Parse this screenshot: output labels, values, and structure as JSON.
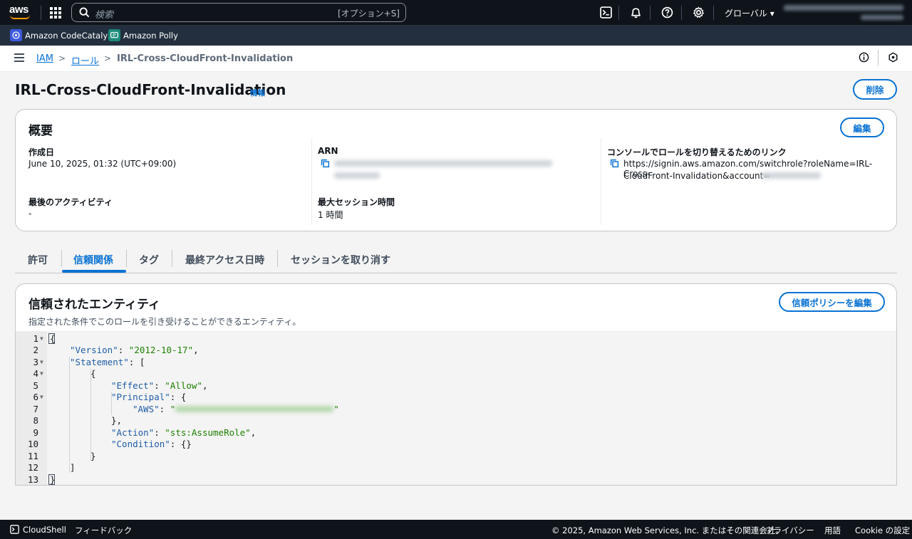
{
  "topnav": {
    "logo_text": "aws",
    "search_placeholder": "検索",
    "search_shortcut": "[オプション+S]",
    "region": "グローバル ▾"
  },
  "favorites": [
    {
      "label": "Amazon CodeCatalyst",
      "icon": "codecatalyst-icon",
      "color": "#3b5bdb"
    },
    {
      "label": "Amazon Polly",
      "icon": "polly-icon",
      "color": "#1b8a7a"
    }
  ],
  "breadcrumb": {
    "items": [
      "IAM",
      "ロール"
    ],
    "current": "IRL-Cross-CloudFront-Invalidation"
  },
  "page": {
    "title": "IRL-Cross-CloudFront-Invalidation",
    "info_label": "情報",
    "delete_label": "削除"
  },
  "summary": {
    "title": "概要",
    "edit_label": "編集",
    "created_label": "作成日",
    "created_value": "June 10, 2025, 01:32 (UTC+09:00)",
    "last_activity_label": "最後のアクティビティ",
    "last_activity_value": "-",
    "arn_label": "ARN",
    "max_session_label": "最大セッション時間",
    "max_session_value": "1 時間",
    "switch_link_label": "コンソールでロールを切り替えるためのリンク",
    "switch_link_line1": "https://signin.aws.amazon.com/switchrole?roleName=IRL-Cross-",
    "switch_link_line2": "CloudFront-Invalidation&account="
  },
  "tabs": [
    {
      "label": "許可",
      "active": false
    },
    {
      "label": "信頼関係",
      "active": true
    },
    {
      "label": "タグ",
      "active": false
    },
    {
      "label": "最終アクセス日時",
      "active": false
    },
    {
      "label": "セッションを取り消す",
      "active": false
    }
  ],
  "trust": {
    "title": "信頼されたエンティティ",
    "subtitle": "指定された条件でこのロールを引き受けることができるエンティティ。",
    "edit_policy_label": "信頼ポリシーを編集",
    "line_numbers": [
      "1",
      "2",
      "3",
      "4",
      "5",
      "6",
      "7",
      "8",
      "9",
      "10",
      "11",
      "12",
      "13"
    ],
    "code": {
      "l1": "{",
      "l2_key": "\"Version\"",
      "l2_sep": ": ",
      "l2_val": "\"2012-10-17\"",
      "l2_end": ",",
      "l3_key": "\"Statement\"",
      "l3_end": ": [",
      "l4": "{",
      "l5_key": "\"Effect\"",
      "l5_sep": ": ",
      "l5_val": "\"Allow\"",
      "l5_end": ",",
      "l6_key": "\"Principal\"",
      "l6_end": ": {",
      "l7_key": "\"AWS\"",
      "l7_sep": ": ",
      "l7_quote_open": "\"",
      "l7_quote_close": "\"",
      "l8": "},",
      "l9_key": "\"Action\"",
      "l9_sep": ": ",
      "l9_val": "\"sts:AssumeRole\"",
      "l9_end": ",",
      "l10_key": "\"Condition\"",
      "l10_end": ": {}",
      "l11": "}",
      "l12": "]",
      "l13": "}"
    }
  },
  "footer": {
    "cloudshell": "CloudShell",
    "feedback": "フィードバック",
    "copyright": "© 2025, Amazon Web Services, Inc. またはその関連会社。",
    "privacy": "プライバシー",
    "terms": "用語",
    "cookie": "Cookie の設定"
  },
  "colors": {
    "link": "#0972d3",
    "topnav": "#0f141a",
    "favbar": "#232f3e",
    "string": "#1d8102",
    "key": "#1f5da6"
  }
}
